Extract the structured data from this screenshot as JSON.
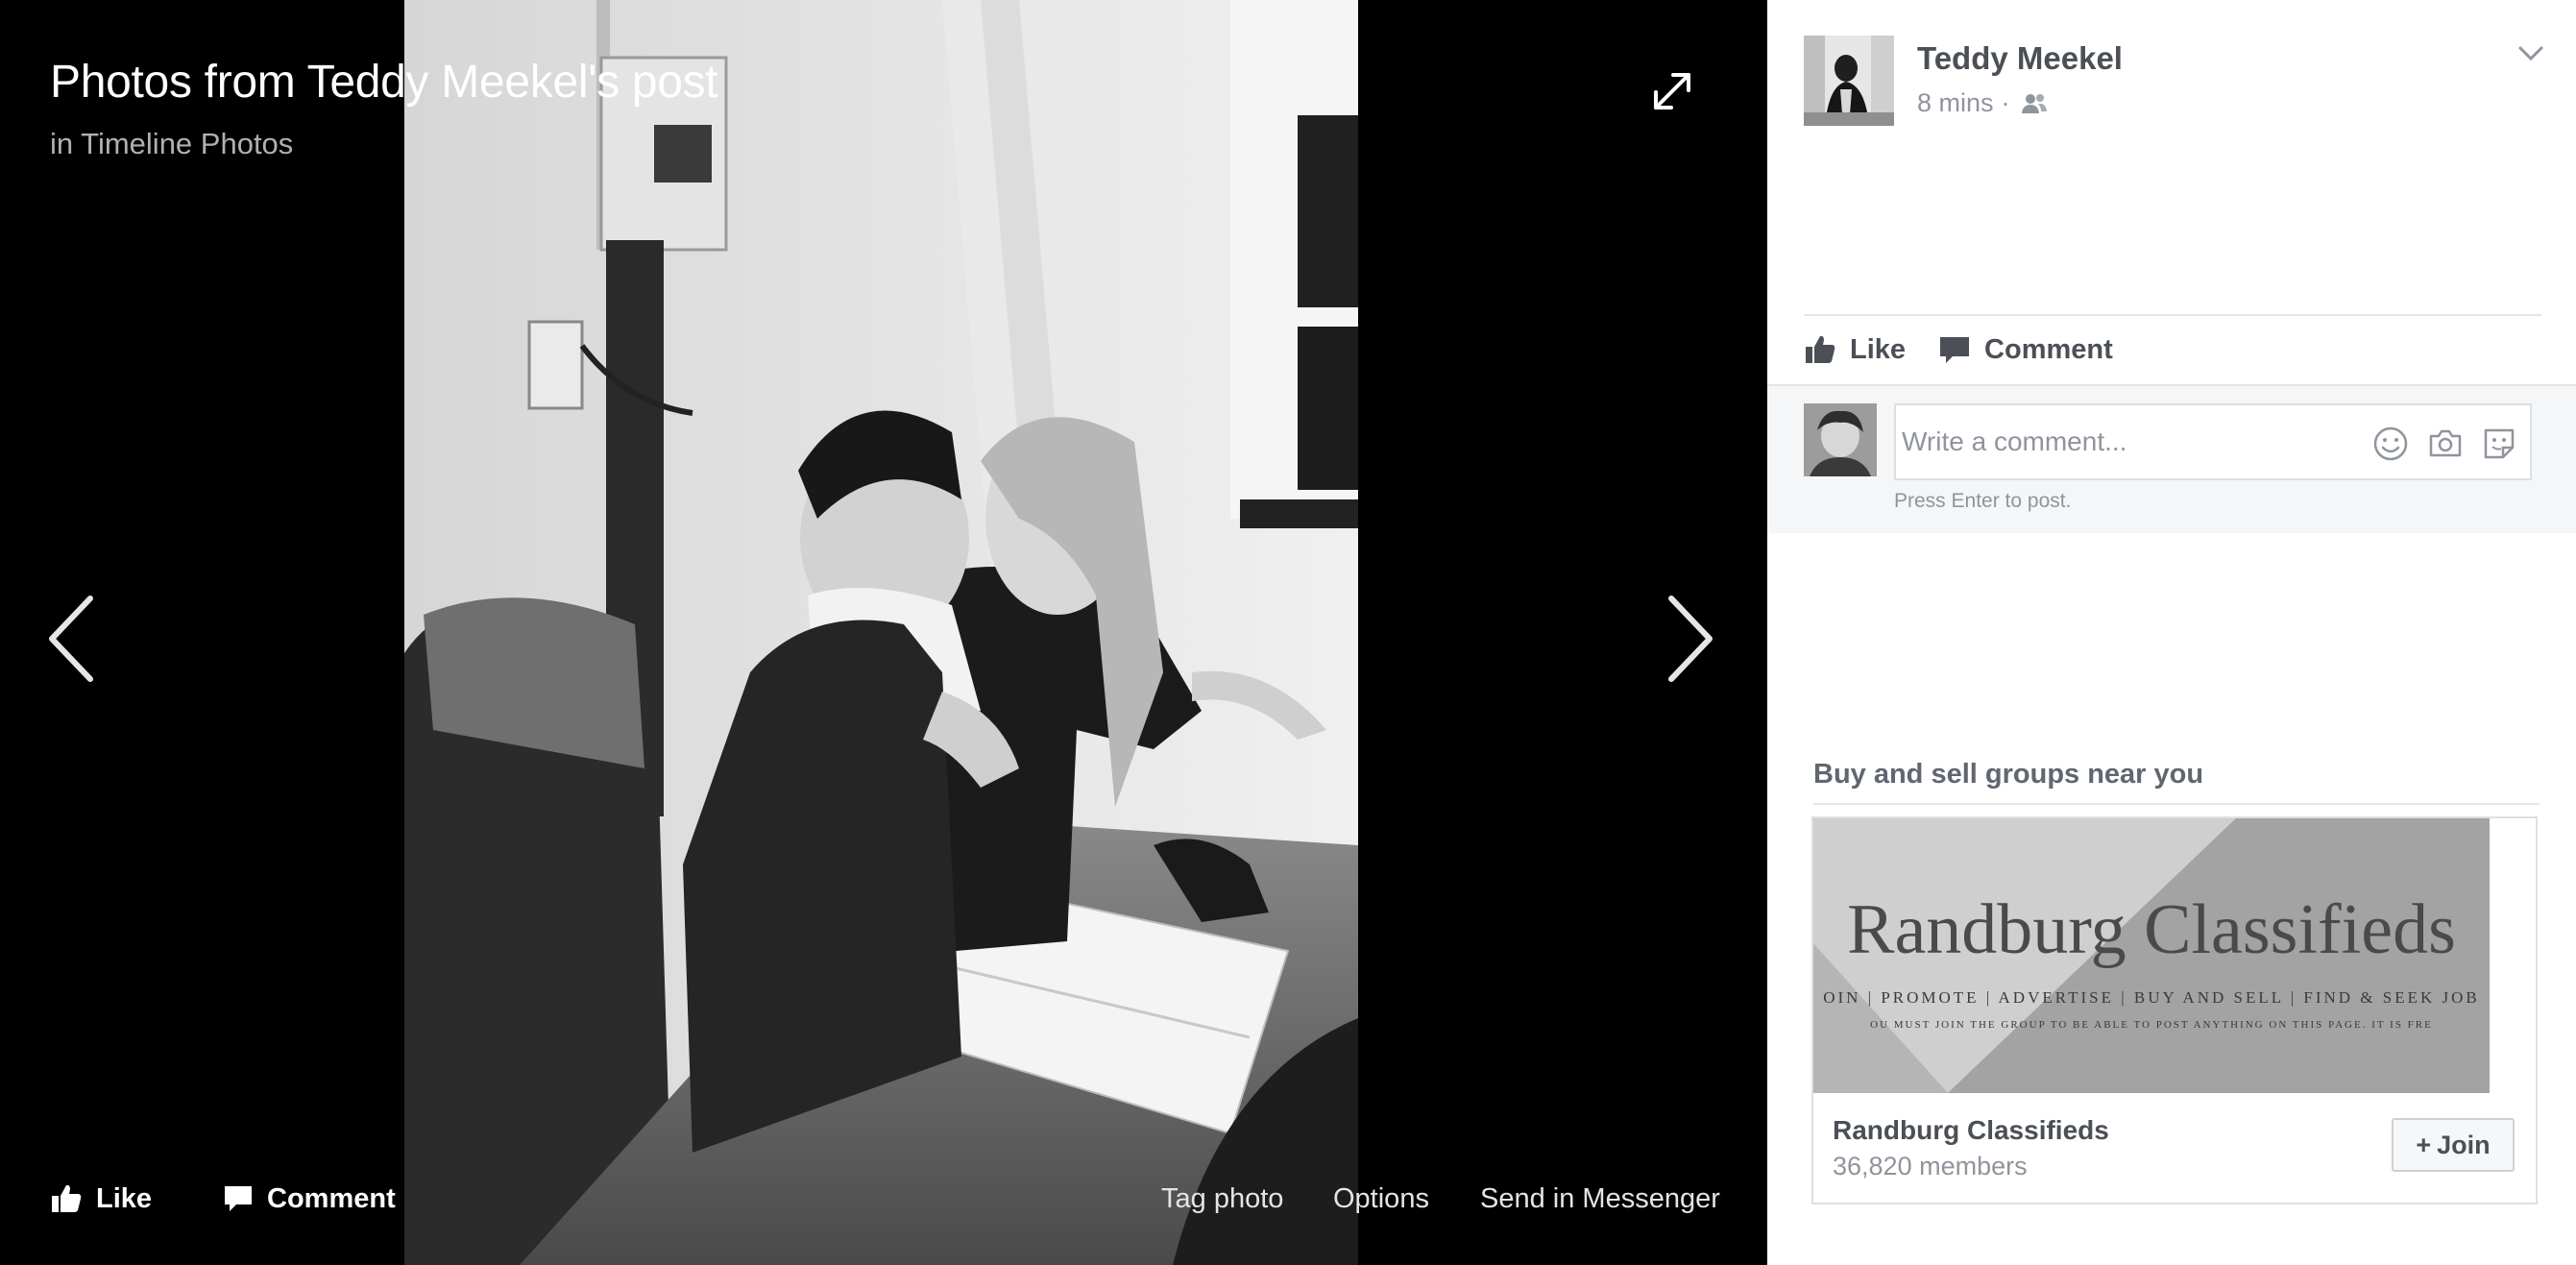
{
  "viewer": {
    "title": "Photos from Teddy Meekel's post",
    "subtitle": "in Timeline Photos",
    "icons": {
      "expand": "expand-icon",
      "previous": "chevron-left-icon",
      "next": "chevron-right-icon"
    },
    "bottom_bar": {
      "like_label": "Like",
      "comment_label": "Comment",
      "tag_label": "Tag photo",
      "options_label": "Options",
      "messenger_label": "Send in Messenger"
    }
  },
  "post": {
    "author_name": "Teddy Meekel",
    "time": "8 mins",
    "separator": "·",
    "audience_icon": "friends-icon",
    "actions": {
      "like_label": "Like",
      "comment_label": "Comment"
    },
    "comment": {
      "placeholder": "Write a comment...",
      "hint": "Press Enter to post.",
      "icons": [
        "emoji-icon",
        "camera-icon",
        "sticker-icon"
      ]
    }
  },
  "suggestions": {
    "title": "Buy and sell groups near you",
    "group": {
      "image_heading": "Randburg Classifieds",
      "image_tagline": "OIN | PROMOTE | ADVERTISE | BUY AND SELL | FIND & SEEK JOB",
      "image_notice": "OU MUST JOIN THE GROUP TO BE ABLE TO POST ANYTHING ON THIS PAGE. IT IS FRE",
      "name": "Randburg Classifieds",
      "members": "36,820 members",
      "join_plus": "+",
      "join_label": "Join"
    }
  },
  "colors": {
    "viewer_background": "#000000",
    "panel_background": "#ffffff",
    "text_secondary": "#90949c",
    "text_primary": "#4b4f56"
  }
}
